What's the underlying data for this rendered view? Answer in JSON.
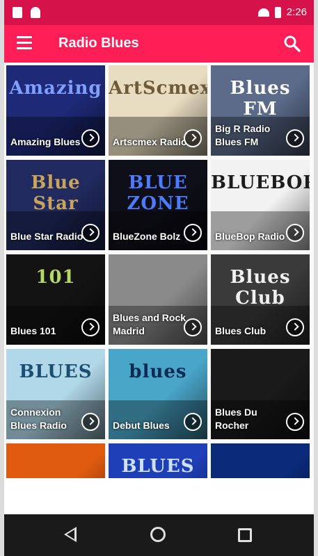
{
  "statusbar": {
    "time": "2:26"
  },
  "appbar": {
    "title": "Radio Blues"
  },
  "icons": [
    "menu-icon",
    "search-icon",
    "play-icon",
    "wifi-icon",
    "battery-icon"
  ],
  "colors": {
    "statusbar": "#d5124a",
    "appbar": "#ff1f56",
    "navbar": "#1a1a1a"
  },
  "stations": [
    {
      "name": "Amazing Blues",
      "art": "Amazing",
      "bg": "#1e2a78",
      "fg": "#7fa0ff"
    },
    {
      "name": "Artscmex Radio",
      "art": "ArtScmex",
      "bg": "#e8dcc0",
      "fg": "#6d5a3a"
    },
    {
      "name": "Big R Radio Blues FM",
      "art": "Blues FM",
      "bg": "#5a6a88",
      "fg": "#ffffff"
    },
    {
      "name": "Blue Star Radio",
      "art": "Blue Star",
      "bg": "#202a5e",
      "fg": "#c9a45c"
    },
    {
      "name": "BlueZone Bolz",
      "art": "BLUE ZONE",
      "bg": "#0e0e18",
      "fg": "#4d7bff"
    },
    {
      "name": "BlueBop Radio",
      "art": "BLUEBOP",
      "bg": "#f2f2f2",
      "fg": "#1c1c1c"
    },
    {
      "name": "Blues 101",
      "art": "101",
      "bg": "#131313",
      "fg": "#b8d866"
    },
    {
      "name": "Blues and Rock Madrid",
      "art": "",
      "bg": "#8a8a8a",
      "fg": "#ffffff"
    },
    {
      "name": "Blues Club",
      "art": "Blues Club",
      "bg": "#3a3a3a",
      "fg": "#f0f0f0"
    },
    {
      "name": "Connexion Blues Radio",
      "art": "BLUES",
      "bg": "#b0d8e8",
      "fg": "#1b4f72"
    },
    {
      "name": "Debut Blues",
      "art": "blues",
      "bg": "#4aa6c8",
      "fg": "#0d2a55"
    },
    {
      "name": "Blues Du Rocher",
      "art": "",
      "bg": "#1a1a1a",
      "fg": "#d8a040"
    },
    {
      "name": "",
      "art": "",
      "bg": "#e05a10",
      "fg": "#ffd040"
    },
    {
      "name": "",
      "art": "BLUES",
      "bg": "#1e3fb8",
      "fg": "#cde0ff"
    },
    {
      "name": "",
      "art": "",
      "bg": "#0a2a7a",
      "fg": "#6fa8ff"
    }
  ]
}
